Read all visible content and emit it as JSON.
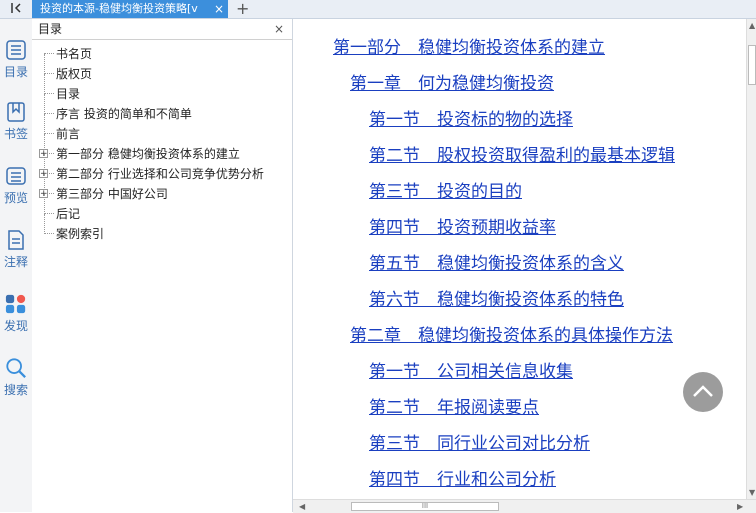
{
  "tabbar": {
    "collapse_icon": "collapse-left-icon",
    "tab_title": "投资的本源-稳健均衡投资策略[v",
    "close": "×",
    "add": "+"
  },
  "rail": [
    {
      "label": "目录",
      "icon": "toc-icon"
    },
    {
      "label": "书签",
      "icon": "bookmark-icon"
    },
    {
      "label": "预览",
      "icon": "preview-icon"
    },
    {
      "label": "注释",
      "icon": "note-icon"
    },
    {
      "label": "发现",
      "icon": "discover-icon"
    },
    {
      "label": "搜索",
      "icon": "search-icon"
    }
  ],
  "toc": {
    "title": "目录",
    "close": "×",
    "items": [
      {
        "label": "书名页",
        "expandable": false
      },
      {
        "label": "版权页",
        "expandable": false
      },
      {
        "label": "目录",
        "expandable": false
      },
      {
        "label": "序言 投资的简单和不简单",
        "expandable": false
      },
      {
        "label": "前言",
        "expandable": false
      },
      {
        "label": "第一部分 稳健均衡投资体系的建立",
        "expandable": true
      },
      {
        "label": "第二部分 行业选择和公司竞争优势分析",
        "expandable": true
      },
      {
        "label": "第三部分 中国好公司",
        "expandable": true
      },
      {
        "label": "后记",
        "expandable": false
      },
      {
        "label": "案例索引",
        "expandable": false
      }
    ],
    "expander_symbol": "+"
  },
  "doc": {
    "lines": [
      {
        "text": "第一部分　稳健均衡投资体系的建立",
        "level": 0
      },
      {
        "text": "第一章　何为稳健均衡投资",
        "level": 1
      },
      {
        "text": "第一节　投资标的物的选择",
        "level": 2
      },
      {
        "text": "第二节　股权投资取得盈利的最基本逻辑",
        "level": 2
      },
      {
        "text": "第三节　投资的目的",
        "level": 2
      },
      {
        "text": "第四节　投资预期收益率",
        "level": 2
      },
      {
        "text": "第五节　稳健均衡投资体系的含义",
        "level": 2
      },
      {
        "text": "第六节　稳健均衡投资体系的特色",
        "level": 2
      },
      {
        "text": "第二章　稳健均衡投资体系的具体操作方法",
        "level": 1
      },
      {
        "text": "第一节　公司相关信息收集",
        "level": 2
      },
      {
        "text": "第二节　年报阅读要点",
        "level": 2
      },
      {
        "text": "第三节　同行业公司对比分析",
        "level": 2
      },
      {
        "text": "第四节　行业和公司分析",
        "level": 2
      }
    ]
  },
  "scroll_top_icon": "chevron-up-icon",
  "scrollbar": {
    "h_grip": "III"
  }
}
